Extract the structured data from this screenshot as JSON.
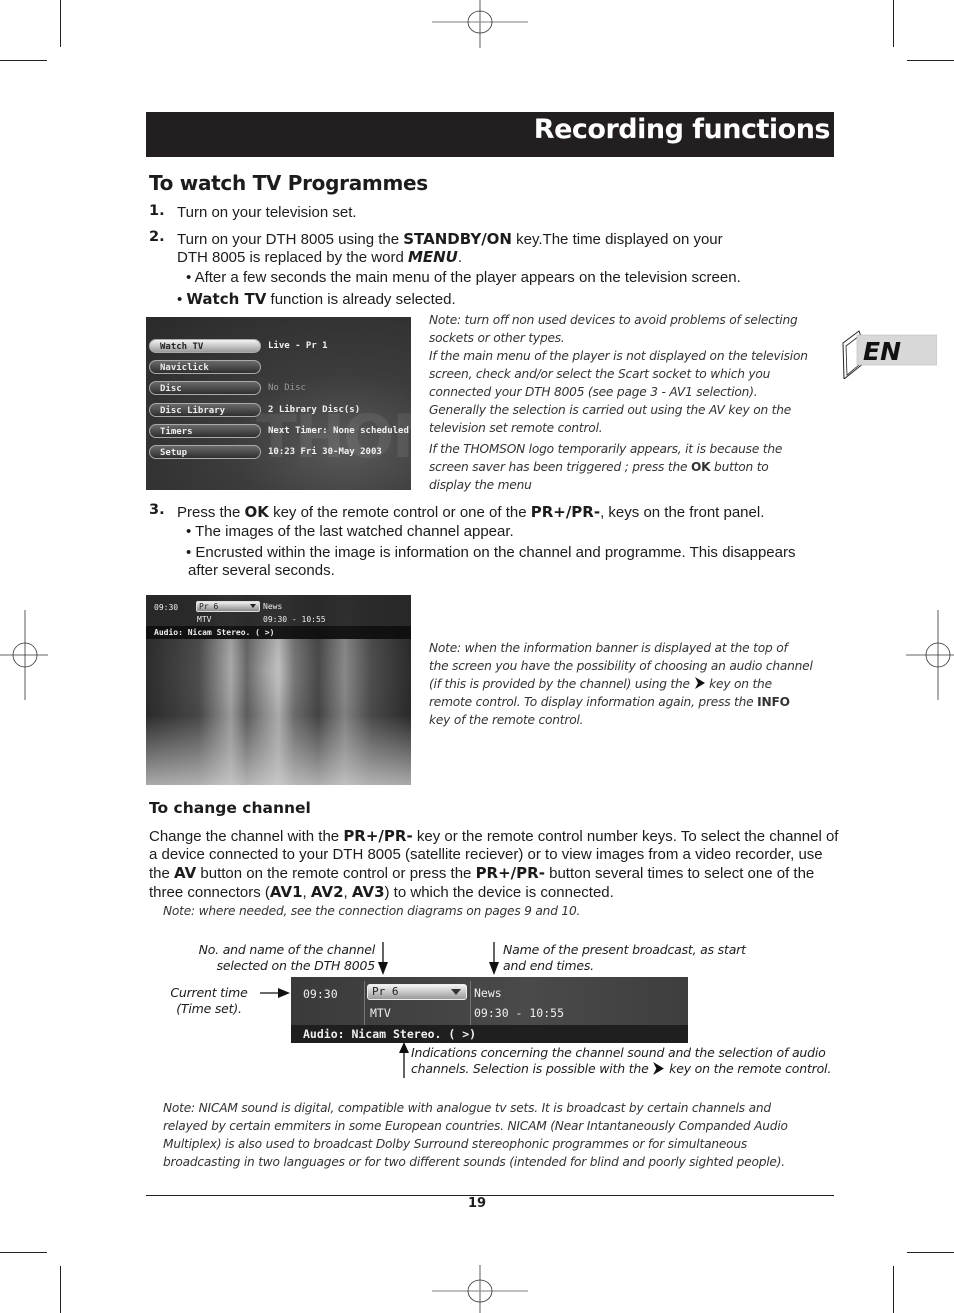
{
  "header": {
    "title": "Recording functions"
  },
  "language_tab": {
    "label": "EN"
  },
  "section_watch": {
    "title": "To watch TV Programmes",
    "steps": [
      {
        "number": "1.",
        "text": "Turn on your television set."
      },
      {
        "number": "2.",
        "text_pre": "Turn on your DTH 8005 using the ",
        "key": "STANDBY/ON",
        "text_mid": " key.The time displayed on your",
        "line2_pre": "DTH 8005 is replaced by the word ",
        "word": "MENU",
        "line2_post": ".",
        "bullets": [
          {
            "text": "• After a few seconds the main menu of the player appears on the television screen."
          },
          {
            "bold": "Watch TV",
            "prefix": "• ",
            "text": " function is already selected."
          }
        ]
      },
      {
        "number": "3.",
        "text_pre": "Press the ",
        "key1": "OK",
        "text_mid": " key of the remote control or one of the ",
        "key2": "PR+/PR-",
        "text_post": ", keys on the front panel.",
        "bullets": [
          "• The images of the last watched channel appear.",
          "• Encrusted within the image is information on the channel and programme. This disappears",
          "after several seconds."
        ]
      }
    ],
    "note1": {
      "lines": [
        "Note: turn off non used devices to avoid problems of selecting",
        "sockets or other types.",
        "If the main menu of the player is not displayed on the television",
        "screen, check and/or select the Scart socket to which you",
        "connected your DTH 8005 (see page 3 - AV1 selection).",
        "Generally the selection is carried out using the AV key on the",
        "television set remote control."
      ],
      "thomson_line1": "If the THOMSON logo temporarily appears, it is because the",
      "thomson_line2_pre": "screen saver has been triggered ; press the ",
      "thomson_key": "OK",
      "thomson_line2_post": " button to",
      "thomson_line3": "display the menu"
    },
    "note2": {
      "line1": "Note: when the information banner is displayed at the top of",
      "line2": "the screen you have the possibility of choosing an audio channel",
      "line3_pre": "(if this is provided by the channel) using the ",
      "line3_post": " key on the",
      "line4_pre": "remote control. To display information again, press the ",
      "key": "INFO",
      "line5": "key of the remote control."
    }
  },
  "tv_menu": {
    "watermark": "THOMSON",
    "items": [
      {
        "label": "Watch TV",
        "value": "Live - Pr 1",
        "selected": true,
        "dim": false
      },
      {
        "label": "Naviclick",
        "value": "",
        "selected": false,
        "dim": false
      },
      {
        "label": "Disc",
        "value": "No Disc",
        "selected": false,
        "dim": true
      },
      {
        "label": "Disc Library",
        "value": "2 Library Disc(s)",
        "selected": false,
        "dim": false
      },
      {
        "label": "Timers",
        "value": "Next Timer: None scheduled",
        "selected": false,
        "dim": false
      },
      {
        "label": "Setup",
        "value": "10:23 Fri 30-May 2003",
        "selected": false,
        "dim": false
      }
    ]
  },
  "info_banner": {
    "time": "09:30",
    "channel_number": "Pr  6",
    "channel_name": "MTV",
    "programme": "News",
    "programme_times": "09:30 - 10:55",
    "audio": "Audio: Nicam Stereo.  ( >)"
  },
  "section_change": {
    "title": "To change channel",
    "para": [
      {
        "t": "Change the channel with the "
      },
      {
        "b": "PR+/PR-"
      },
      {
        "t": " key or the remote control number keys. To select the channel of a device connected to your DTH 8005 (satellite reciever) or to view images from a video recorder, use the "
      },
      {
        "b": "AV"
      },
      {
        "t": " button on the remote control or press the "
      },
      {
        "b": "PR+/PR-"
      },
      {
        "t": " button several times to select one of the three connectors ("
      },
      {
        "b": "AV1"
      },
      {
        "t": ", "
      },
      {
        "b": "AV2"
      },
      {
        "t": ", "
      },
      {
        "b": "AV3"
      },
      {
        "t": ") to which the device is connected."
      }
    ],
    "note": "Note: where needed, see the connection diagrams on pages 9 and 10."
  },
  "diagram": {
    "ann_channel_l1": "No. and name of the channel",
    "ann_channel_l2": "selected on the DTH 8005",
    "ann_broadcast_l1": "Name of the present broadcast, as start",
    "ann_broadcast_l2": "and end times.",
    "ann_time_l1": "Current time",
    "ann_time_l2": "(Time set).",
    "ann_audio_l1": "Indications concerning the channel sound and the selection of audio",
    "ann_audio_l2_pre": "channels. Selection is possible with the ",
    "ann_audio_l2_post": " key on the remote control."
  },
  "nicam_note": {
    "lines": [
      "Note: NICAM sound is digital, compatible with analogue tv sets. It is broadcast by certain channels and",
      "relayed by certain emmiters in some European countries. NICAM (Near Intantaneously Companded Audio",
      "Multiplex) is also used to broadcast Dolby Surround stereophonic programmes or for simultaneous",
      "broadcasting in two languages or for two different sounds (intended for blind and poorly sighted people)."
    ]
  },
  "footer": {
    "page_number": "19"
  }
}
